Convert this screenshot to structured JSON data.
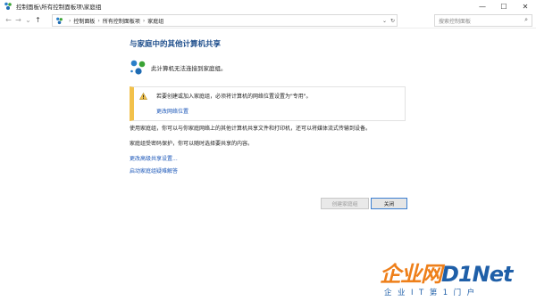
{
  "window": {
    "title": "控制面板\\所有控制面板项\\家庭组",
    "controls": [
      "—",
      "☐",
      "✕"
    ]
  },
  "nav": {
    "back": "←",
    "forward": "→",
    "dropdown": "⌄",
    "up": "↑",
    "breadcrumbs": [
      "控制面板",
      "所有控制面板项",
      "家庭组"
    ],
    "separator": "›",
    "refresh": "↻",
    "search_placeholder": "搜索控制面板",
    "search_icon": "search-icon"
  },
  "main": {
    "heading": "与家庭中的其他计算机共享",
    "status_text": "此计算机无法连接到家庭组。",
    "warning": {
      "text": "若要创建或加入家庭组，必须将计算机的网络位置设置为\"专用\"。",
      "link": "更改网络位置"
    },
    "para1": "使用家庭组，你可以与你家庭网络上的其他计算机共享文件和打印机，还可以将媒体流式传输到设备。",
    "para2": "家庭组受密码保护，你可以随时选择要共享的内容。",
    "link_advanced": "更改高级共享设置...",
    "link_troubleshooter": "启动家庭组疑难解答"
  },
  "buttons": {
    "create": "创建家庭组",
    "close": "关闭"
  },
  "watermark": {
    "logo_a": "企业网",
    "logo_b": "D1Net",
    "tagline": "企业IT第1门户"
  },
  "colors": {
    "link": "#1a56b8",
    "heading": "#1e4e8c",
    "warning_bar": "#f2c14b",
    "watermark_orange": "#ee7f1a",
    "watermark_blue": "#1f5fa8"
  }
}
